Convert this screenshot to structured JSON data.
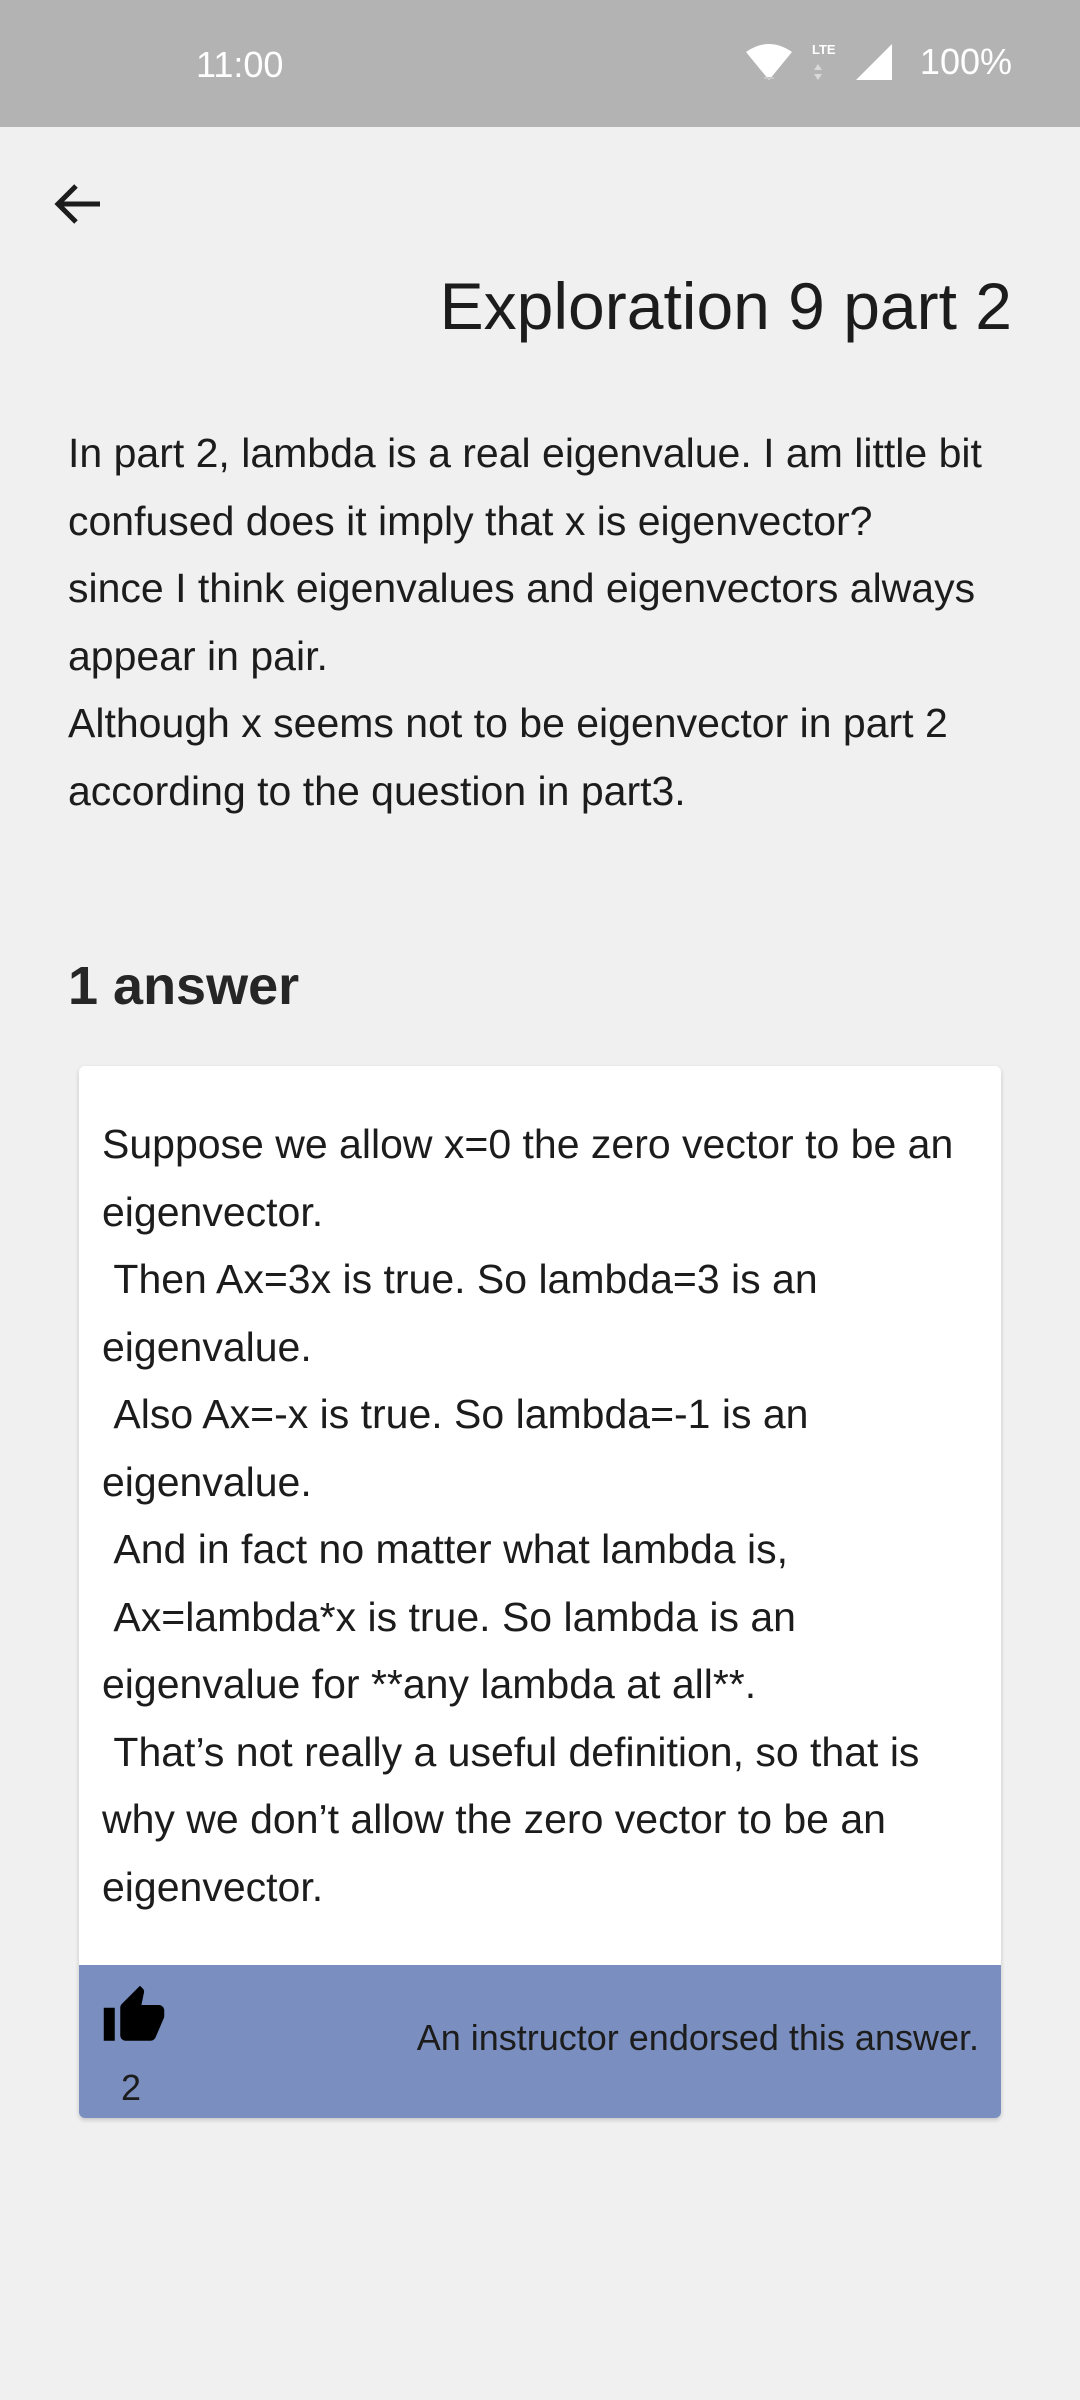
{
  "status_bar": {
    "time": "11:00",
    "battery": "100%",
    "network_label": "LTE",
    "icons": [
      "wifi-icon",
      "lte-icon",
      "signal-icon"
    ]
  },
  "header": {
    "back_icon": "arrow-left-icon",
    "title": "Exploration 9 part 2"
  },
  "question": {
    "lines": [
      "In part 2, lambda is a real eigenvalue. I am little bit confused does it imply that x is eigenvector?",
      "since I think eigenvalues and eigenvectors always appear in pair.",
      "Although x seems not to be eigenvector in part 2 according to the question in part3."
    ]
  },
  "answers": {
    "heading": "1 answer",
    "items": [
      {
        "lines": [
          "Suppose we allow x=0 the zero vector to be an eigenvector.",
          " Then Ax=3x is true. So lambda=3 is an eigenvalue.",
          " Also Ax=-x is true. So lambda=-1 is an eigenvalue.",
          " And in fact no matter what lambda is,",
          " Ax=lambda*x is true. So lambda is an eigenvalue for **any lambda at all**.",
          " That’s not really a useful definition, so that is why we don’t allow the zero vector to be an eigenvector."
        ],
        "like_icon": "thumbs-up-icon",
        "likes": "2",
        "endorsement": "An instructor endorsed this answer.",
        "footer_color": "#7a8fbf"
      }
    ]
  }
}
